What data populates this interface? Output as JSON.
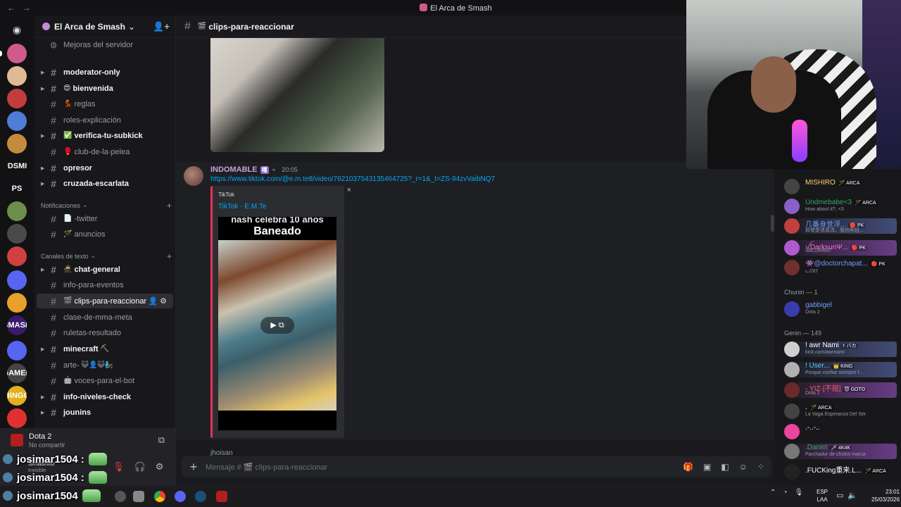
{
  "window": {
    "title": "El Arca de Smash",
    "back": "←",
    "forward": "→"
  },
  "servers": [
    {
      "label": "",
      "color": "#d05a8a"
    },
    {
      "label": "",
      "color": "#e2b996"
    },
    {
      "label": "",
      "color": "#c23c3c"
    },
    {
      "label": "",
      "color": "#4f7cd6"
    },
    {
      "label": "",
      "color": "#c58b3c"
    },
    {
      "label": "PDSMM",
      "color": "#121214"
    },
    {
      "label": "PS",
      "color": "#121214"
    },
    {
      "label": "",
      "color": "#6b8f4a"
    },
    {
      "label": "",
      "color": "#4a4a4a"
    },
    {
      "label": "",
      "color": "#d04040"
    },
    {
      "label": "",
      "color": "#5865f2"
    },
    {
      "label": "",
      "color": "#e7a02a"
    },
    {
      "label": "SMASH",
      "color": "#3a1b6a"
    },
    {
      "label": "",
      "color": "#5865f2"
    },
    {
      "label": "GAMER",
      "color": "#444"
    },
    {
      "label": "BINGO",
      "color": "#e0b020"
    },
    {
      "label": "",
      "color": "#e03030"
    }
  ],
  "server_header": {
    "name": "El Arca de Smash",
    "chevron": "⌄",
    "add_icon": "👤+"
  },
  "channels": {
    "boost": "Mejoras del servidor",
    "list": [
      {
        "name": "moderator-only",
        "emoji": ""
      },
      {
        "name": "bienvenida",
        "emoji": "😍"
      },
      {
        "name": "reglas",
        "emoji": "💃"
      },
      {
        "name": "roles-explicación",
        "emoji": ""
      },
      {
        "name": "verifica-tu-subkick",
        "emoji": "✅"
      },
      {
        "name": "club-de-la-pelea",
        "emoji": "🥊"
      },
      {
        "name": "opresor",
        "emoji": ""
      },
      {
        "name": "cruzada-escarlata",
        "emoji": ""
      }
    ],
    "cat_notif": "Notificaciones",
    "notif": [
      {
        "name": "-twitter",
        "emoji": "📄"
      },
      {
        "name": "anuncios",
        "emoji": "🪄"
      }
    ],
    "cat_text": "Canales de texto",
    "text": [
      {
        "name": "chat-general",
        "emoji": "🥷"
      },
      {
        "name": "info-para-eventos",
        "emoji": ""
      },
      {
        "name": "clips-para-reaccionar",
        "emoji": "🎬"
      },
      {
        "name": "clase-de-mma-meta",
        "emoji": ""
      },
      {
        "name": "ruletas-resultado",
        "emoji": ""
      },
      {
        "name": "minecraft",
        "emoji": "⛏️"
      },
      {
        "name": "arte-",
        "emoji": "😺👤😺🧞"
      },
      {
        "name": "voces-para-el-bot",
        "emoji": "🤖"
      },
      {
        "name": "info-niveles-check",
        "emoji": ""
      },
      {
        "name": "jounins",
        "emoji": ""
      }
    ]
  },
  "activity": {
    "game": "Dota 2",
    "status": "No compartir",
    "user": "Smashito",
    "user_status": "Invisible"
  },
  "overlay": {
    "name": "josimar1504 :",
    "name_last": "josimar1504"
  },
  "channel_header": {
    "name": "clips-para-reaccionar"
  },
  "message": {
    "author": "INDOMABLE",
    "tag": "嘿",
    "time": "20:05",
    "link": "https://www.tiktok.com/@e.m.te8/video/7621037543135464725?_r=1&_t=ZS-94zvVaibNQ7",
    "provider": "TikTok",
    "embed_title": "TikTok · E.M.Te",
    "close": "×",
    "video_caption_1": "nash celebra 10 años",
    "video_caption_2": "Baneado",
    "play": "▶ ⧉",
    "next_author": "jhoisan"
  },
  "composer": {
    "placeholder": "Mensaje # 🎬 clips-para-reaccionar",
    "plus": "+"
  },
  "members": {
    "top": [
      {
        "name": "MISHIRO",
        "tag": "🪄 ARCA",
        "sub": "",
        "color": "#ffd66b",
        "avatar": "#444"
      },
      {
        "name": "Undmebabe<3",
        "tag": "🪄 ARCA",
        "sub": "How about it?, <3",
        "color": "#3ba55c",
        "avatar": "#8a5fc8"
      },
      {
        "name": "几番身世浮...",
        "tag": "🔴 PK",
        "sub": "即使是浪真流、我也明目...",
        "color": "#6f9cff",
        "avatar": "#c04040"
      },
      {
        "name": "ꪜDarksunΨ...",
        "tag": "🔴 PK",
        "sub": "VALORANT",
        "color": "#ff73e0",
        "avatar": "#b05ad0"
      },
      {
        "name": "👾@doctorchapat...",
        "tag": "🔴 PK",
        "sub": "ᓚᘏᗢ",
        "color": "#6f9cff",
        "avatar": "#703030"
      }
    ],
    "group1": "Chunin — 1",
    "g1": [
      {
        "name": "gabbigel",
        "tag": "",
        "sub": "Dota 2",
        "color": "#6f9cff",
        "avatar": "#3b3bb0"
      }
    ],
    "group2": "Genin — 149",
    "g2": [
      {
        "name": "! awr Nami",
        "tag": "⚕ バカ",
        "sub": "kick.com/awrnami",
        "color": "#ffffff",
        "avatar": "#cfcfcf"
      },
      {
        "name": "! User...",
        "tag": "👑 KING",
        "sub": "Porque confiar siempre f...",
        "color": "#4fd1ff",
        "avatar": "#b0b0b0"
      },
      {
        "name": "- YIZ-[不屈]",
        "tag": "😈 GOTO",
        "sub": "Dota 2",
        "color": "#ff5a5a",
        "avatar": "#6a2a2a"
      },
      {
        "name": ".",
        "tag": "🪄 ARCA",
        "sub": "La Vaga Esperanza Del Ser",
        "color": "#ffffff",
        "avatar": "#444"
      },
      {
        "name": ".-..-..",
        "tag": "",
        "sub": "",
        "color": "#ffffff",
        "avatar": "#eb459e"
      },
      {
        "name": ".Daniel",
        "tag": "🗡 4K4K",
        "sub": "Parchador de cholos marca",
        "color": "#3ba55c",
        "avatar": "#777"
      },
      {
        "name": ".FUCKing重来.L...",
        "tag": "🪄 ARCA",
        "sub": "",
        "color": "#ffffff",
        "avatar": "#222"
      }
    ]
  },
  "tray": {
    "lang1": "ESP",
    "lang2": "LAA",
    "time": "23:01",
    "date": "25/03/2026"
  }
}
